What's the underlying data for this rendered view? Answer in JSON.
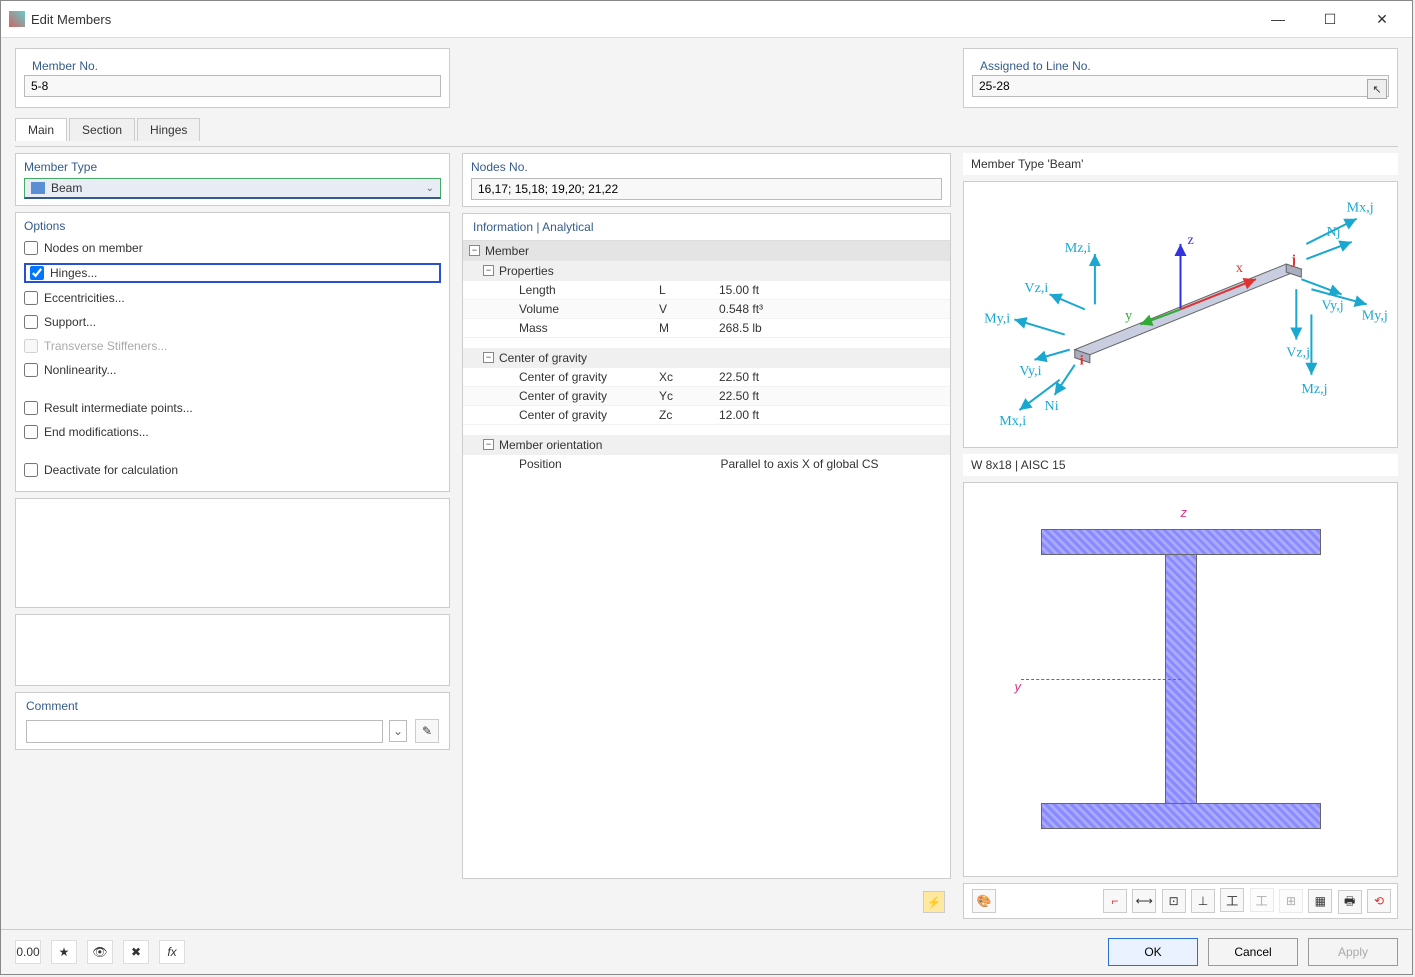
{
  "window": {
    "title": "Edit Members"
  },
  "header": {
    "member_no_label": "Member No.",
    "member_no_value": "5-8",
    "assigned_label": "Assigned to Line No.",
    "assigned_value": "25-28"
  },
  "tabs": {
    "main": "Main",
    "section": "Section",
    "hinges": "Hinges"
  },
  "member_type": {
    "label": "Member Type",
    "value": "Beam"
  },
  "options": {
    "label": "Options",
    "items": [
      {
        "key": "nodes_on_member",
        "label": "Nodes on member",
        "checked": false,
        "disabled": false
      },
      {
        "key": "hinges",
        "label": "Hinges...",
        "checked": true,
        "disabled": false,
        "highlighted": true
      },
      {
        "key": "eccentricities",
        "label": "Eccentricities...",
        "checked": false,
        "disabled": false
      },
      {
        "key": "support",
        "label": "Support...",
        "checked": false,
        "disabled": false
      },
      {
        "key": "transverse_stiffeners",
        "label": "Transverse Stiffeners...",
        "checked": false,
        "disabled": true
      },
      {
        "key": "nonlinearity",
        "label": "Nonlinearity...",
        "checked": false,
        "disabled": false
      },
      {
        "key": "result_intermediate",
        "label": "Result intermediate points...",
        "checked": false,
        "disabled": false
      },
      {
        "key": "end_modifications",
        "label": "End modifications...",
        "checked": false,
        "disabled": false
      },
      {
        "key": "deactivate",
        "label": "Deactivate for calculation",
        "checked": false,
        "disabled": false
      }
    ]
  },
  "nodes_no": {
    "label": "Nodes No.",
    "value": "16,17; 15,18; 19,20; 21,22"
  },
  "info": {
    "header": "Information | Analytical",
    "member": "Member",
    "properties": "Properties",
    "props": [
      {
        "name": "Length",
        "sym": "L",
        "val": "15.00 ft"
      },
      {
        "name": "Volume",
        "sym": "V",
        "val": "0.548 ft³"
      },
      {
        "name": "Mass",
        "sym": "M",
        "val": "268.5 lb"
      }
    ],
    "center_of_gravity": "Center of gravity",
    "cog": [
      {
        "name": "Center of gravity",
        "sym": "Xc",
        "val": "22.50 ft"
      },
      {
        "name": "Center of gravity",
        "sym": "Yc",
        "val": "22.50 ft"
      },
      {
        "name": "Center of gravity",
        "sym": "Zc",
        "val": "12.00 ft"
      }
    ],
    "orientation": "Member orientation",
    "position_label": "Position",
    "position_value": "Parallel to axis X of global CS"
  },
  "preview": {
    "beam_label": "Member Type 'Beam'",
    "section_label": "W 8x18 | AISC 15",
    "axes": {
      "x": "x",
      "y": "y",
      "z": "z"
    },
    "forces": {
      "Mzi": "Mz,i",
      "Vzi": "Vz,i",
      "Myi": "My,i",
      "Vyi": "Vy,i",
      "Ni": "Ni",
      "Mxi": "Mx,i",
      "Mxj": "Mx,j",
      "Nj": "Nj",
      "Vyj": "Vy,j",
      "Myj": "My,j",
      "Vzj": "Vz,j",
      "Mzj": "Mz,j",
      "i": "i",
      "j": "j"
    }
  },
  "comment": {
    "label": "Comment",
    "value": ""
  },
  "buttons": {
    "ok": "OK",
    "cancel": "Cancel",
    "apply": "Apply"
  }
}
